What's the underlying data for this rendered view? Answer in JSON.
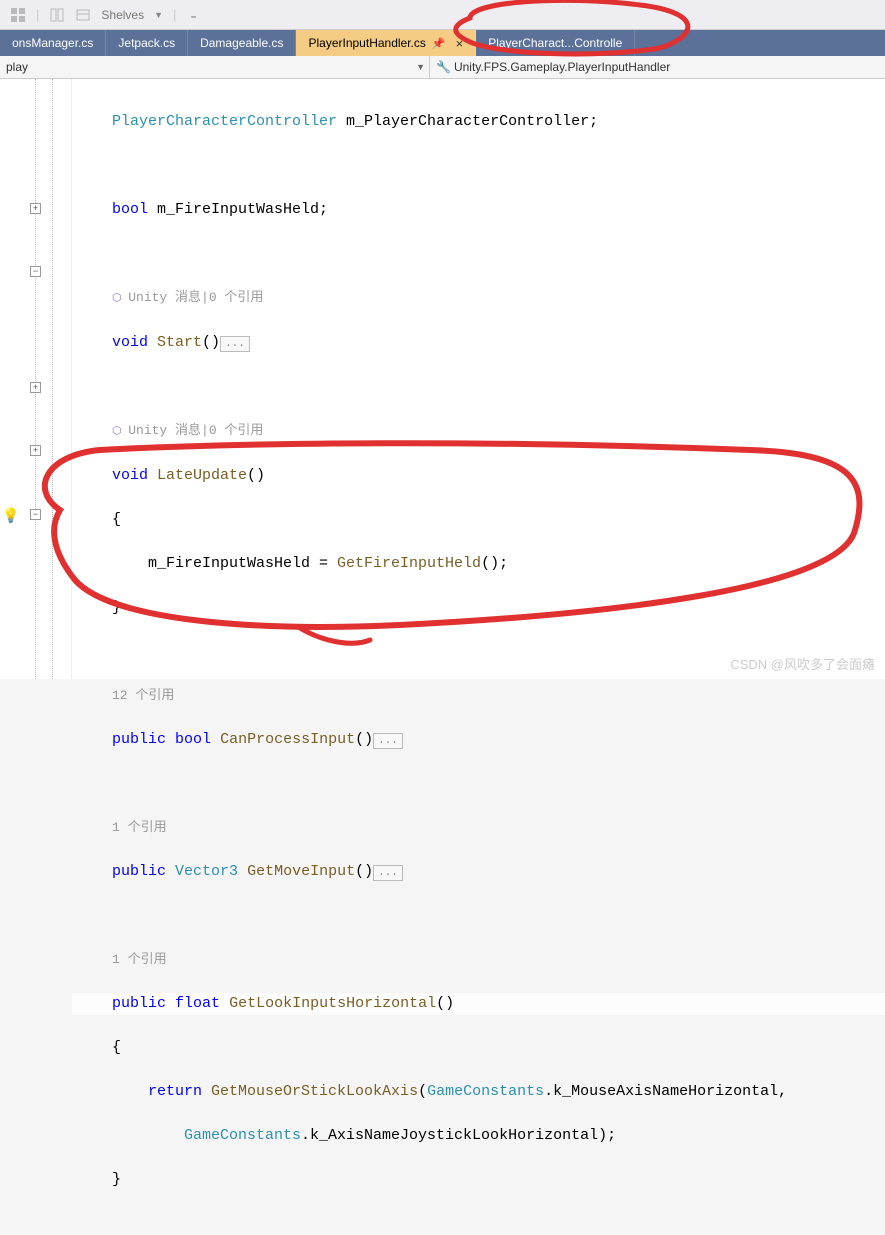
{
  "toolbar": {
    "shelves_label": "Shelves",
    "overflow_glyph": "₌"
  },
  "tabs": [
    {
      "label": "onsManager.cs"
    },
    {
      "label": "Jetpack.cs"
    },
    {
      "label": "Damageable.cs"
    },
    {
      "label": "PlayerInputHandler.cs",
      "active": true
    },
    {
      "label": "PlayerCharact...Controlle"
    }
  ],
  "nav": {
    "left": "play",
    "right": "Unity.FPS.Gameplay.PlayerInputHandler"
  },
  "code": {
    "l1_type": "PlayerCharacterController",
    "l1_field": " m_PlayerCharacterController;",
    "l2_kw": "bool",
    "l2_rest": " m_FireInputWasHeld;",
    "lens1": "Unity 消息|0 个引用",
    "l3_kw": "void",
    "l3_method": "Start",
    "l3_paren": "()",
    "dots": "...",
    "lens2": "Unity 消息|0 个引用",
    "l4_kw": "void",
    "l4_method": "LateUpdate",
    "l4_paren": "()",
    "brace_open": "{",
    "l5_body": "m_FireInputWasHeld = ",
    "l5_call": "GetFireInputHeld",
    "l5_end": "();",
    "brace_close": "}",
    "lens3": "12 个引用",
    "l6_kw1": "public",
    "l6_kw2": "bool",
    "l6_method": "CanProcessInput",
    "l6_paren": "()",
    "lens4": "1 个引用",
    "l7_kw1": "public",
    "l7_type": "Vector3",
    "l7_method": "GetMoveInput",
    "l7_paren": "()",
    "lens5": "1 个引用",
    "l8_kw1": "public",
    "l8_kw2": "float",
    "l8_method": "GetLookInputsHorizontal",
    "l8_paren": "()",
    "l9_kw": "return",
    "l9_call": "GetMouseOrStickLookAxis",
    "l9_p1": "(",
    "l9_type1": "GameConstants",
    "l9_mem1": ".k_MouseAxisNameHorizontal,",
    "l10_type": "GameConstants",
    "l10_mem": ".k_AxisNameJoystickLookHorizontal);"
  },
  "watermark": "CSDN @风吹多了会面瘫"
}
